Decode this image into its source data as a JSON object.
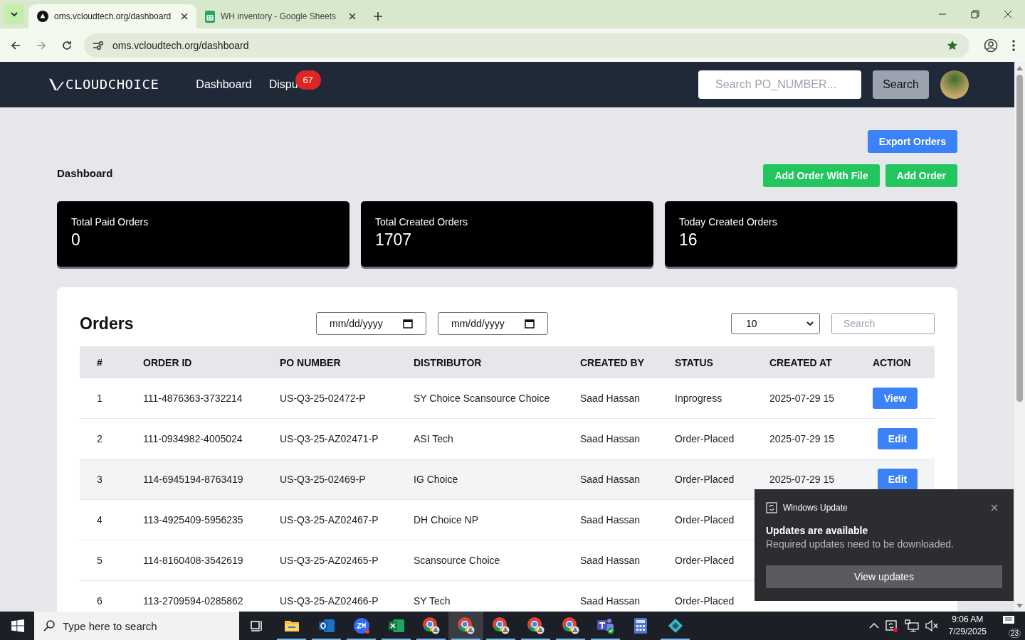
{
  "browser": {
    "tabs": [
      {
        "title": "oms.vcloudtech.org/dashboard",
        "kind": "site",
        "selected": true
      },
      {
        "title": "WH inventory - Google Sheets",
        "kind": "sheets",
        "selected": false
      }
    ],
    "url": "oms.vcloudtech.org/dashboard",
    "bookmarked": true
  },
  "navbar": {
    "logo": "CLOUDCHOICE",
    "links": [
      {
        "label": "Dashboard"
      },
      {
        "label": "Dispu",
        "badge": "67"
      }
    ],
    "search": {
      "placeholder": "Search PO_NUMBER..."
    },
    "search_button": "Search"
  },
  "page": {
    "title": "Dashboard",
    "buttons": [
      {
        "label": "Export Orders",
        "kind": "primary"
      },
      {
        "label": "Add Order With File",
        "kind": "success"
      },
      {
        "label": "Add Order",
        "kind": "success"
      }
    ],
    "stats": [
      {
        "label": "Total Paid Orders",
        "value": "0"
      },
      {
        "label": "Total Created Orders",
        "value": "1707"
      },
      {
        "label": "Today Created Orders",
        "value": "16"
      }
    ]
  },
  "orders": {
    "title": "Orders",
    "date_from": {
      "placeholder": "mm/dd/yyyy"
    },
    "date_to": {
      "placeholder": "mm/dd/yyyy"
    },
    "page_size": "10",
    "search": {
      "placeholder": "Search"
    },
    "columns": [
      "#",
      "ORDER ID",
      "PO NUMBER",
      "DISTRIBUTOR",
      "CREATED BY",
      "STATUS",
      "CREATED AT",
      "ACTION"
    ],
    "rows": [
      {
        "cells": [
          "1",
          "111-4876363-3732214",
          "US-Q3-25-02472-P",
          "SY Choice Scansource Choice",
          "Saad Hassan",
          "Inprogress",
          "2025-07-29 15"
        ],
        "action": "View",
        "hovered": false
      },
      {
        "cells": [
          "2",
          "111-0934982-4005024",
          "US-Q3-25-AZ02471-P",
          "ASI Tech",
          "Saad Hassan",
          "Order-Placed",
          "2025-07-29 15"
        ],
        "action": "Edit",
        "hovered": false
      },
      {
        "cells": [
          "3",
          "114-6945194-8763419",
          "US-Q3-25-02469-P",
          "IG Choice",
          "Saad Hassan",
          "Order-Placed",
          "2025-07-29 15"
        ],
        "action": "Edit",
        "hovered": true
      },
      {
        "cells": [
          "4",
          "113-4925409-5956235",
          "US-Q3-25-AZ02467-P",
          "DH Choice NP",
          "Saad Hassan",
          "Order-Placed"
        ],
        "hovered": false
      },
      {
        "cells": [
          "5",
          "114-8160408-3542619",
          "US-Q3-25-AZ02465-P",
          "Scansource Choice",
          "Saad Hassan",
          "Order-Placed"
        ],
        "hovered": false
      },
      {
        "cells": [
          "6",
          "113-2709594-0285862",
          "US-Q3-25-AZ02466-P",
          "SY Tech",
          "Saad Hassan",
          "Order-Placed"
        ],
        "hovered": false
      }
    ]
  },
  "notification": {
    "app": "Windows Update",
    "title": "Updates are available",
    "body": "Required updates need to be downloaded.",
    "button": "View updates"
  },
  "taskbar": {
    "search": {
      "placeholder": "Type here to search"
    },
    "apps": [
      {
        "kind": "taskview",
        "active": false
      },
      {
        "kind": "folder",
        "active": true
      },
      {
        "kind": "outlook",
        "active": true
      },
      {
        "kind": "zoom",
        "active": true
      },
      {
        "kind": "excel",
        "active": true
      },
      {
        "kind": "chrome",
        "active": true
      },
      {
        "kind": "chrome",
        "active": true,
        "selected": true
      },
      {
        "kind": "chrome",
        "active": true
      },
      {
        "kind": "chrome",
        "active": true
      },
      {
        "kind": "chrome",
        "active": true
      },
      {
        "kind": "teams",
        "active": true
      },
      {
        "kind": "calculator",
        "active": false
      },
      {
        "kind": "diamond",
        "active": true
      }
    ],
    "time": "9:06 AM",
    "date": "7/29/2025",
    "notifications": "23"
  }
}
